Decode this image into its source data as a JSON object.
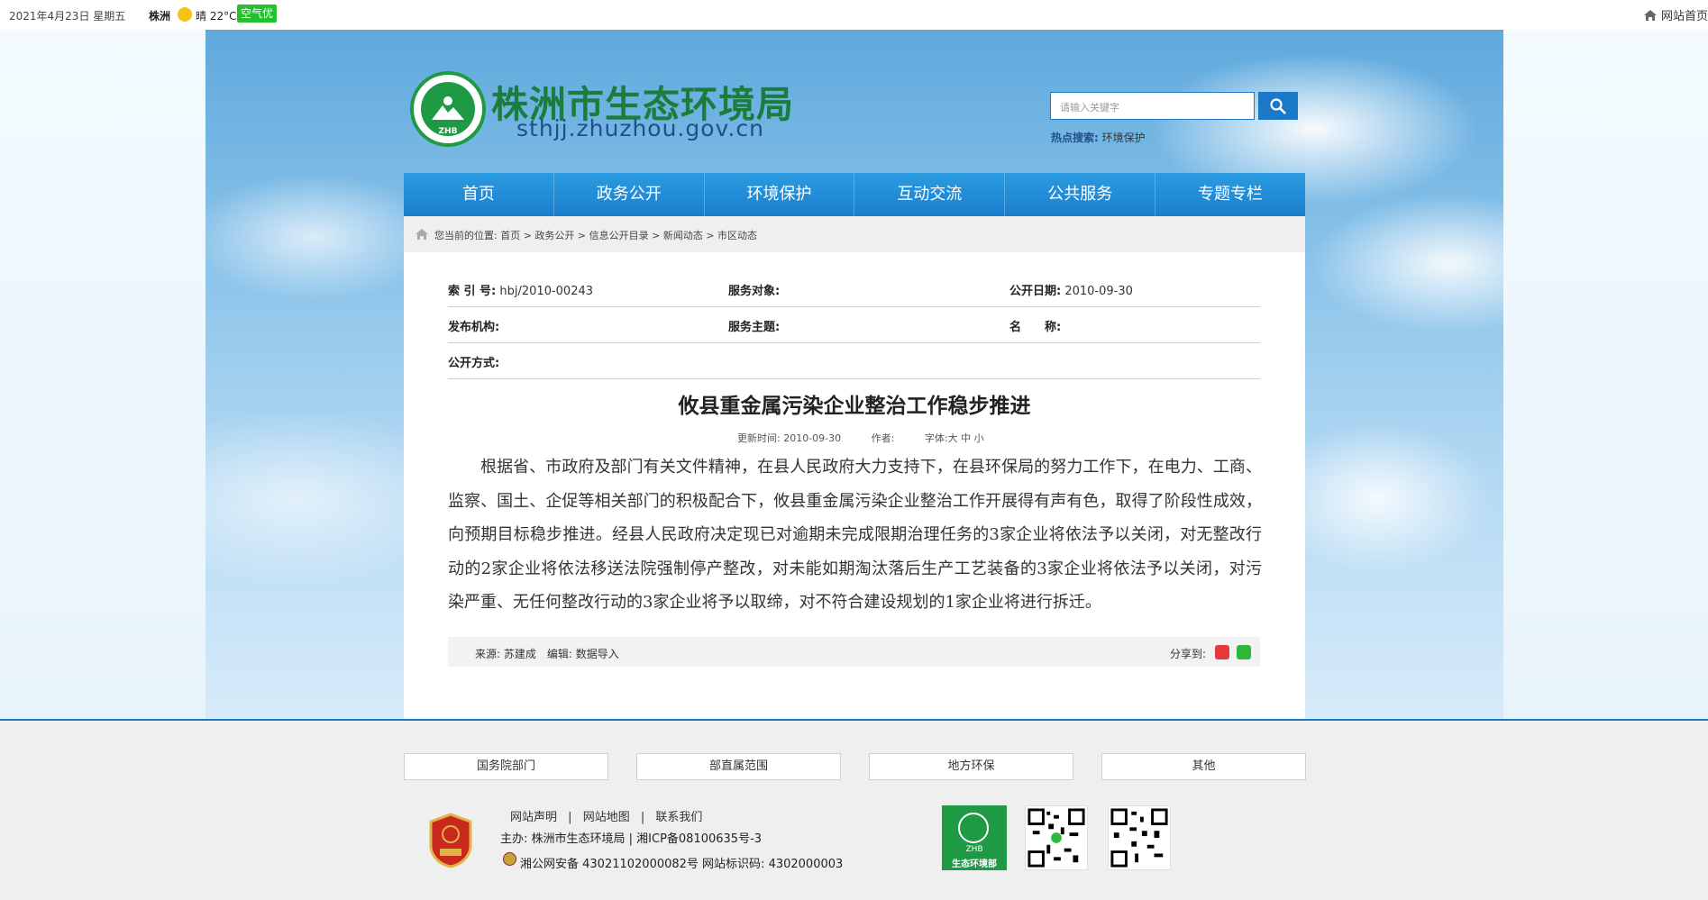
{
  "topbar": {
    "date": "2021年4月23日 星期五",
    "city": "株洲",
    "weather": "晴 22°C",
    "aqi_label": "空气优",
    "home_link": "网站首页"
  },
  "header": {
    "title": "株洲市生态环境局",
    "domain": "sthjj.zhuzhou.gov.cn",
    "logo_text": "ZHB",
    "search_placeholder": "请输入关键字",
    "hot_label": "热点搜索:",
    "hot_keyword": "环境保护"
  },
  "nav": [
    "首页",
    "政务公开",
    "环境保护",
    "互动交流",
    "公共服务",
    "专题专栏"
  ],
  "breadcrumb": "您当前的位置: 首页 > 政务公开 > 信息公开目录 > 新闻动态 > 市区动态",
  "meta": {
    "index_label": "索 引 号:",
    "index_value": "hbj/2010-00243",
    "target_label": "服务对象:",
    "date_label": "公开日期:",
    "date_value": "2010-09-30",
    "org_label": "发布机构:",
    "topic_label": "服务主题:",
    "name_label": "名　　称:",
    "method_label": "公开方式:"
  },
  "article": {
    "title": "攸县重金属污染企业整治工作稳步推进",
    "updated_label": "更新时间:",
    "updated_value": "2010-09-30",
    "author_label": "作者:",
    "font_size_label": "字体:大 中 小",
    "body": "根据省、市政府及部门有关文件精神，在县人民政府大力支持下，在县环保局的努力工作下，在电力、工商、监察、国土、企促等相关部门的积极配合下，攸县重金属污染企业整治工作开展得有声有色，取得了阶段性成效，向预期目标稳步推进。经县人民政府决定现已对逾期未完成限期治理任务的3家企业将依法予以关闭，对无整改行动的2家企业将依法移送法院强制停产整改，对未能如期淘汰落后生产工艺装备的3家企业将依法予以关闭，对污染严重、无任何整改行动的3家企业将予以取缔，对不符合建设规划的1家企业将进行拆迁。",
    "source_line": "来源: 苏建成　编辑: 数据导入",
    "share_label": "分享到:"
  },
  "footer": {
    "links_boxes": [
      "国务院部门",
      "部直属范围",
      "地方环保",
      "其他"
    ],
    "links": [
      "网站声明",
      "网站地图",
      "联系我们"
    ],
    "host": "主办: 株洲市生态环境局 | 湘ICP备08100635号-3",
    "police": "湘公网安备 43021102000082号  网站标识码: 4302000003",
    "zhb_text": "ZHB",
    "zhb_caption": "生态环境部"
  },
  "colors": {
    "nav_blue": "#1a7fce",
    "title_green": "#1a7d3c",
    "aqi_green": "#24c02e"
  }
}
